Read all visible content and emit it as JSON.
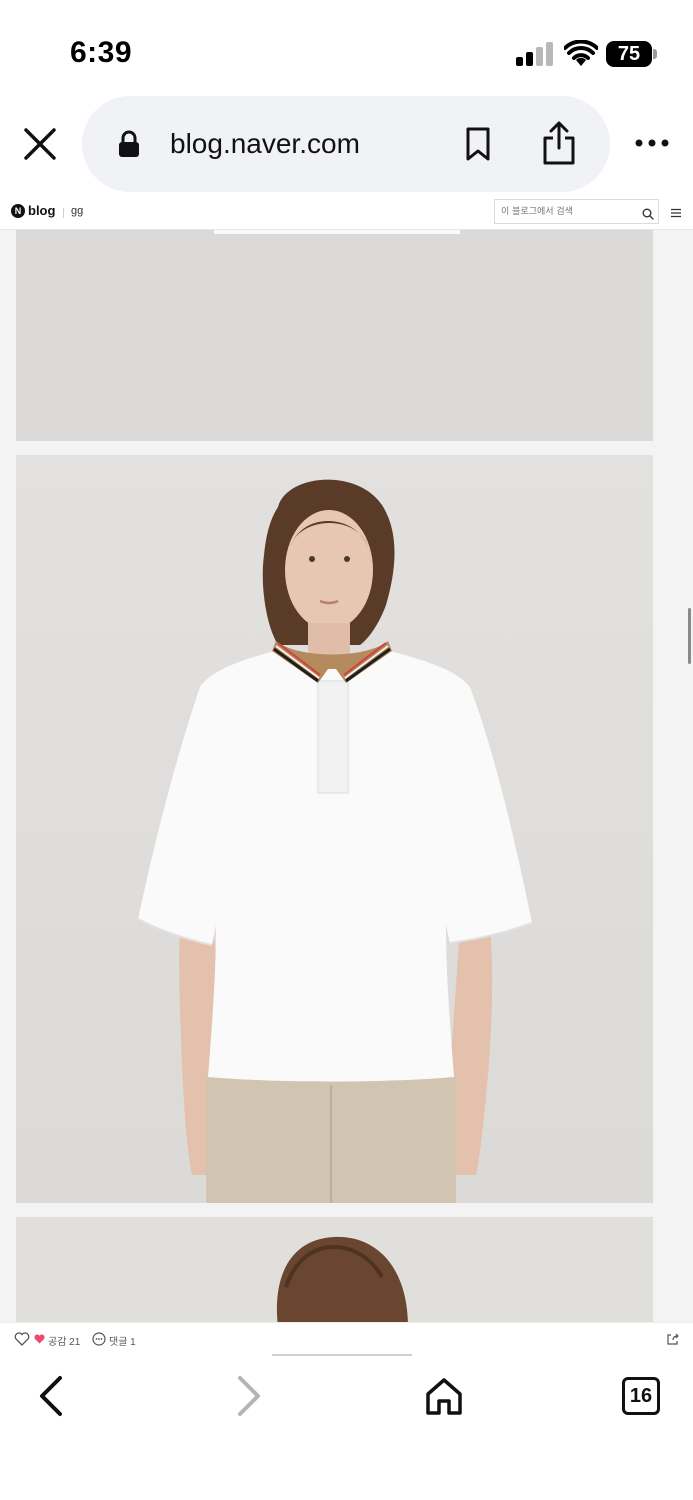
{
  "status_bar": {
    "time": "6:39",
    "battery": "75"
  },
  "browser": {
    "url": "blog.naver.com",
    "tab_count": "16"
  },
  "blog_header": {
    "logo_letter": "N",
    "label": "blog",
    "blog_name": "gg",
    "search_placeholder": "이 블로그에서 검색"
  },
  "post_bar": {
    "like_label": "공감 21",
    "comment_label": "댓글 1"
  },
  "icons": {
    "close": "close-icon",
    "lock": "lock-icon",
    "bookmark": "bookmark-icon",
    "share": "share-icon",
    "more": "more-icon",
    "search": "search-icon",
    "menu": "menu-icon",
    "back": "chevron-left-icon",
    "forward": "chevron-right-icon",
    "home": "home-icon"
  },
  "colors": {
    "like_heart": "#ec4a6e",
    "url_pill": "#f1f2f6",
    "photo_background": "#dedcda"
  }
}
